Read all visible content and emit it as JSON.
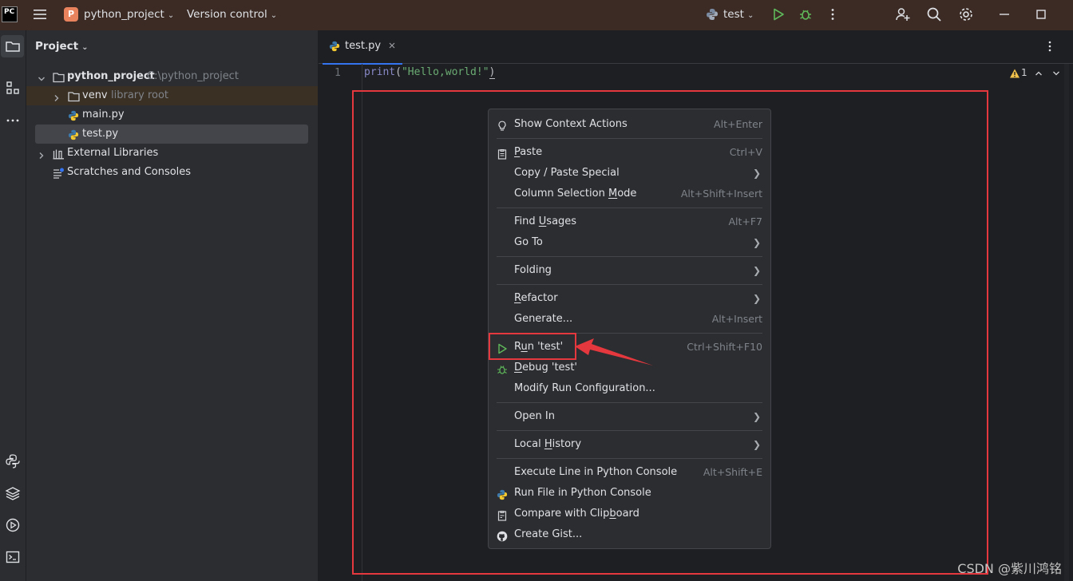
{
  "titlebar": {
    "logo_text": "PC",
    "project_badge": "P",
    "project_name": "python_project",
    "version_control": "Version control",
    "run_config": "test"
  },
  "project_panel": {
    "title": "Project",
    "root_name": "python_project",
    "root_path": "C:\\python_project",
    "venv_name": "venv",
    "venv_hint": "library root",
    "file_main": "main.py",
    "file_test": "test.py",
    "external_libs": "External Libraries",
    "scratches": "Scratches and Consoles"
  },
  "editor": {
    "tab_label": "test.py",
    "line_number": "1",
    "code_fn": "print",
    "code_open": "(",
    "code_str": "\"Hello,world!\"",
    "code_close": ")",
    "warning_count": "1"
  },
  "context_menu": {
    "show_context_actions": "Show Context Actions",
    "show_context_actions_sc": "Alt+Enter",
    "paste_u": "P",
    "paste_rest": "aste",
    "paste_sc": "Ctrl+V",
    "copy_paste_special": "Copy / Paste Special",
    "column_sel_a": "Column Selection ",
    "column_sel_u": "M",
    "column_sel_b": "ode",
    "column_sel_sc": "Alt+Shift+Insert",
    "find_usages_a": "Find ",
    "find_usages_u": "U",
    "find_usages_b": "sages",
    "find_usages_sc": "Alt+F7",
    "go_to": "Go To",
    "folding": "Folding",
    "refactor_u": "R",
    "refactor_rest": "efactor",
    "generate": "Generate...",
    "generate_sc": "Alt+Insert",
    "run_a": "R",
    "run_u": "u",
    "run_b": "n 'test'",
    "run_sc": "Ctrl+Shift+F10",
    "debug_u": "D",
    "debug_rest": "ebug 'test'",
    "modify_run": "Modify Run Configuration...",
    "open_in": "Open In",
    "local_history_a": "Local ",
    "local_history_u": "H",
    "local_history_b": "istory",
    "execute_line": "Execute Line in Python Console",
    "execute_line_sc": "Alt+Shift+E",
    "run_file_console": "Run File in Python Console",
    "compare_a": "Compare with Clip",
    "compare_u": "b",
    "compare_b": "oard",
    "create_gist": "Create Gist..."
  },
  "watermark": "CSDN @紫川鸿铭",
  "colors": {
    "accent": "#3574f0",
    "highlight": "#e5383e",
    "run_green": "#5fb85a",
    "string_green": "#6aab73"
  }
}
